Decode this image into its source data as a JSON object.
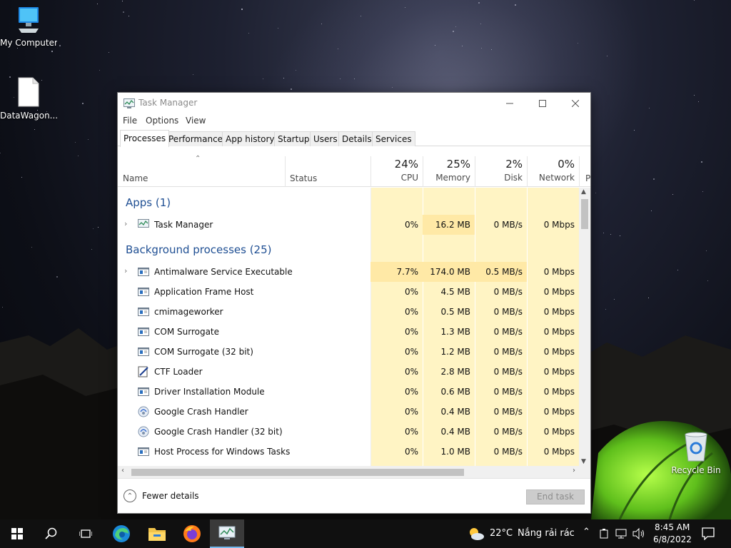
{
  "desktop": {
    "icons": [
      {
        "label": "My Computer",
        "icon": "computer-icon"
      },
      {
        "label": "DataWagon...",
        "icon": "file-icon"
      },
      {
        "label": "Recycle Bin",
        "icon": "recycle-bin-icon"
      }
    ]
  },
  "window": {
    "title": "Task Manager",
    "menu": [
      "File",
      "Options",
      "View"
    ],
    "tabs": [
      "Processes",
      "Performance",
      "App history",
      "Startup",
      "Users",
      "Details",
      "Services"
    ],
    "active_tab": "Processes",
    "columns": {
      "name": "Name",
      "status": "Status",
      "cpu": {
        "pct": "24%",
        "label": "CPU"
      },
      "memory": {
        "pct": "25%",
        "label": "Memory"
      },
      "disk": {
        "pct": "2%",
        "label": "Disk"
      },
      "network": {
        "pct": "0%",
        "label": "Network"
      },
      "power_partial": "P"
    },
    "groups": {
      "apps": "Apps (1)",
      "background": "Background processes (25)"
    },
    "apps": [
      {
        "name": "Task Manager",
        "cpu": "0%",
        "memory": "16.2 MB",
        "disk": "0 MB/s",
        "network": "0 Mbps",
        "expandable": true,
        "icon": "task-manager-icon"
      }
    ],
    "background": [
      {
        "name": "Antimalware Service Executable",
        "cpu": "7.7%",
        "memory": "174.0 MB",
        "disk": "0.5 MB/s",
        "network": "0 Mbps",
        "expandable": true,
        "icon": "service-icon"
      },
      {
        "name": "Application Frame Host",
        "cpu": "0%",
        "memory": "4.5 MB",
        "disk": "0 MB/s",
        "network": "0 Mbps",
        "icon": "service-icon"
      },
      {
        "name": "cmimageworker",
        "cpu": "0%",
        "memory": "0.5 MB",
        "disk": "0 MB/s",
        "network": "0 Mbps",
        "icon": "service-icon"
      },
      {
        "name": "COM Surrogate",
        "cpu": "0%",
        "memory": "1.3 MB",
        "disk": "0 MB/s",
        "network": "0 Mbps",
        "icon": "service-icon"
      },
      {
        "name": "COM Surrogate (32 bit)",
        "cpu": "0%",
        "memory": "1.2 MB",
        "disk": "0 MB/s",
        "network": "0 Mbps",
        "icon": "service-icon"
      },
      {
        "name": "CTF Loader",
        "cpu": "0%",
        "memory": "2.8 MB",
        "disk": "0 MB/s",
        "network": "0 Mbps",
        "icon": "pen-icon"
      },
      {
        "name": "Driver Installation Module",
        "cpu": "0%",
        "memory": "0.6 MB",
        "disk": "0 MB/s",
        "network": "0 Mbps",
        "icon": "service-icon"
      },
      {
        "name": "Google Crash Handler",
        "cpu": "0%",
        "memory": "0.4 MB",
        "disk": "0 MB/s",
        "network": "0 Mbps",
        "icon": "google-crash-icon"
      },
      {
        "name": "Google Crash Handler (32 bit)",
        "cpu": "0%",
        "memory": "0.4 MB",
        "disk": "0 MB/s",
        "network": "0 Mbps",
        "icon": "google-crash-icon"
      },
      {
        "name": "Host Process for Windows Tasks",
        "cpu": "0%",
        "memory": "1.0 MB",
        "disk": "0 MB/s",
        "network": "0 Mbps",
        "icon": "service-icon"
      }
    ],
    "footer": {
      "fewer_details": "Fewer details",
      "end_task": "End task"
    }
  },
  "taskbar": {
    "weather": "22°C",
    "weather_desc": "Nắng rải rác",
    "time": "8:45 AM",
    "date": "6/8/2022",
    "apps": [
      "start-icon",
      "search-icon",
      "task-view-icon",
      "edge-icon",
      "file-explorer-icon",
      "firefox-icon",
      "task-manager-icon"
    ]
  }
}
